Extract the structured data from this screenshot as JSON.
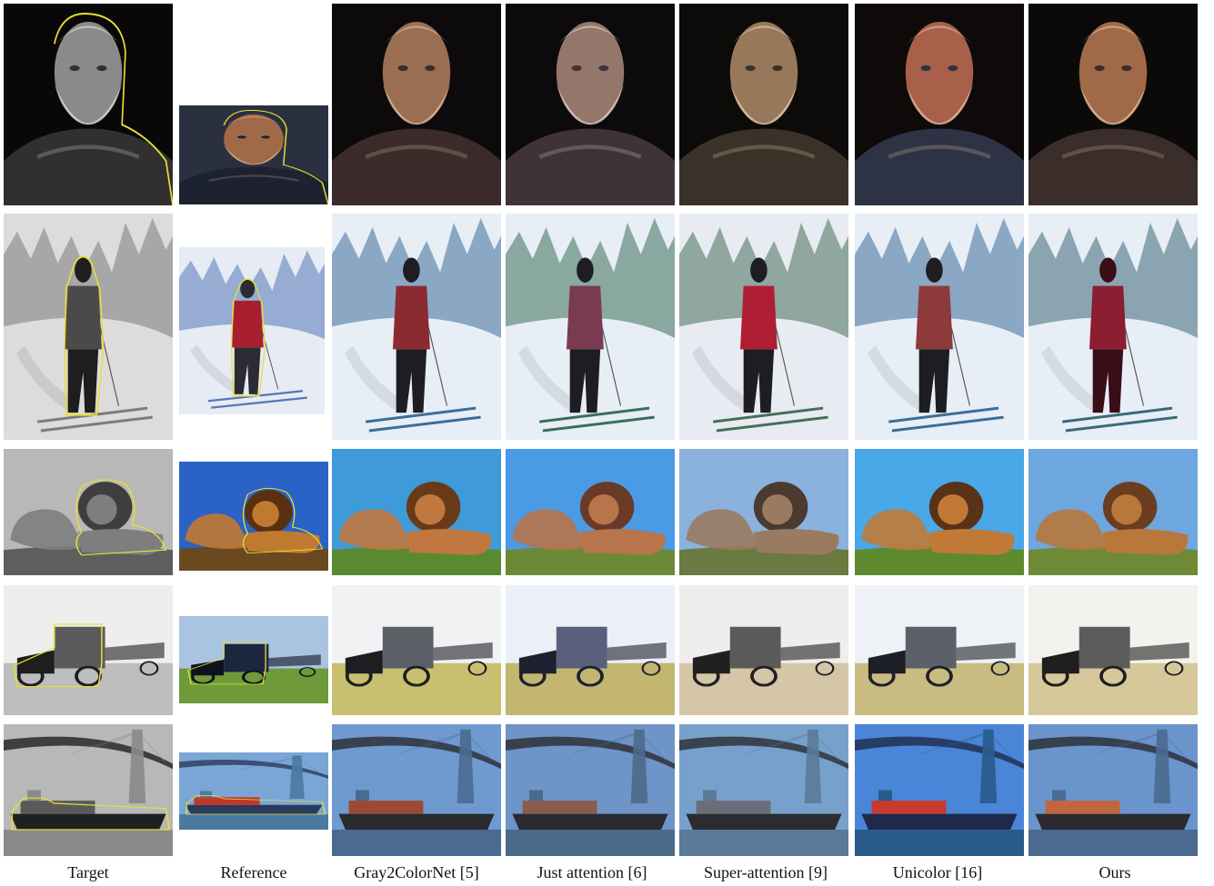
{
  "columns": [
    {
      "key": "target",
      "label": "Target"
    },
    {
      "key": "reference",
      "label": "Reference"
    },
    {
      "key": "gray2colornet",
      "label": "Gray2ColorNet [5]"
    },
    {
      "key": "just_attention",
      "label": "Just attention [6]"
    },
    {
      "key": "super_attention",
      "label": "Super-attention [9]"
    },
    {
      "key": "unicolor",
      "label": "Unicolor [16]"
    },
    {
      "key": "ours",
      "label": "Ours"
    }
  ],
  "rows": [
    {
      "subject": "portrait",
      "palettes": {
        "target": {
          "bg": "#080808",
          "main": "#8a8a8a",
          "dark": "#303030",
          "light": "#d6d6d6"
        },
        "reference": {
          "bg": "#2a3040",
          "main": "#a06a48",
          "dark": "#1c2230",
          "light": "#d9b08a"
        },
        "gray2colornet": {
          "bg": "#0c0a0a",
          "main": "#9a6e52",
          "dark": "#3b2b2b",
          "light": "#d9b79a"
        },
        "just_attention": {
          "bg": "#0c0a0c",
          "main": "#94766a",
          "dark": "#403338",
          "light": "#dcc8bc"
        },
        "super_attention": {
          "bg": "#0c0b09",
          "main": "#98785a",
          "dark": "#3a3228",
          "light": "#dcc6a8"
        },
        "unicolor": {
          "bg": "#0e0a0a",
          "main": "#a8604a",
          "dark": "#2d3344",
          "light": "#e0b89e"
        },
        "ours": {
          "bg": "#0c0a09",
          "main": "#a06a48",
          "dark": "#3b2d2a",
          "light": "#e0b896"
        }
      }
    },
    {
      "subject": "skier",
      "palettes": {
        "target": {
          "bg": "#dcdcdc",
          "main": "#4a4a4a",
          "dark": "#1e1e1e",
          "light": "#7c7c7c"
        },
        "reference": {
          "bg": "#e6ebf4",
          "main": "#a82030",
          "dark": "#2b2b33",
          "light": "#5478b8"
        },
        "gray2colornet": {
          "bg": "#e8eef6",
          "main": "#8c2a32",
          "dark": "#1e1e22",
          "light": "#3c6e9a"
        },
        "just_attention": {
          "bg": "#e8eef6",
          "main": "#7a3a52",
          "dark": "#1e1e22",
          "light": "#3a6f5a"
        },
        "super_attention": {
          "bg": "#e8ecf2",
          "main": "#b01e34",
          "dark": "#1e1e22",
          "light": "#46705a"
        },
        "unicolor": {
          "bg": "#e8eef6",
          "main": "#8e3a3a",
          "dark": "#1e1e22",
          "light": "#3c6e9a"
        },
        "ours": {
          "bg": "#e8eef6",
          "main": "#8c1e32",
          "dark": "#3a0e18",
          "light": "#3c6a78"
        }
      }
    },
    {
      "subject": "lions",
      "palettes": {
        "target": {
          "bg": "#b8b8b8",
          "main": "#7e7e7e",
          "dark": "#3e3e3e",
          "light": "#5e5e5e"
        },
        "reference": {
          "bg": "#2a62c8",
          "main": "#c07a30",
          "dark": "#5a3010",
          "light": "#6a4820"
        },
        "gray2colornet": {
          "bg": "#3e9ad8",
          "main": "#c07840",
          "dark": "#6a3a18",
          "light": "#5a8a30"
        },
        "just_attention": {
          "bg": "#4a9ae6",
          "main": "#b8744a",
          "dark": "#6a3a28",
          "light": "#6a8a38"
        },
        "super_attention": {
          "bg": "#8ab2dc",
          "main": "#9a7a60",
          "dark": "#4a3a30",
          "light": "#6a7a40"
        },
        "unicolor": {
          "bg": "#48a8e8",
          "main": "#c07a36",
          "dark": "#5a3218",
          "light": "#5e8a2e"
        },
        "ours": {
          "bg": "#6ea6e0",
          "main": "#b8783c",
          "dark": "#6a3e1e",
          "light": "#6e8a36"
        }
      }
    },
    {
      "subject": "truck",
      "palettes": {
        "target": {
          "bg": "#eeeeee",
          "main": "#5a5a5a",
          "dark": "#1e1e1e",
          "light": "#bdbdbd"
        },
        "reference": {
          "bg": "#a9c4e0",
          "main": "#1c2640",
          "dark": "#0e1220",
          "light": "#6e9a3a"
        },
        "gray2colornet": {
          "bg": "#f0f2f4",
          "main": "#5c6066",
          "dark": "#1e1e22",
          "light": "#c8c070"
        },
        "just_attention": {
          "bg": "#eaf0f6",
          "main": "#5a607c",
          "dark": "#1e2030",
          "light": "#c2b670"
        },
        "super_attention": {
          "bg": "#f0eeec",
          "main": "#5a5a5a",
          "dark": "#202020",
          "light": "#d4c6a6"
        },
        "unicolor": {
          "bg": "#eef2f6",
          "main": "#5c6068",
          "dark": "#1e2028",
          "light": "#c8bc80"
        },
        "ours": {
          "bg": "#f4f2ee",
          "main": "#5c5c5c",
          "dark": "#1e1e1e",
          "light": "#d6c89a"
        }
      }
    },
    {
      "subject": "ship",
      "palettes": {
        "target": {
          "bg": "#b8b8b8",
          "main": "#5a5a5a",
          "dark": "#202020",
          "light": "#8a8a8a"
        },
        "reference": {
          "bg": "#7aa6d6",
          "main": "#c0382a",
          "dark": "#2a3a5a",
          "light": "#4a7aa0"
        },
        "gray2colornet": {
          "bg": "#6e9ad0",
          "main": "#9a4a32",
          "dark": "#2a2a30",
          "light": "#4a6a90"
        },
        "just_attention": {
          "bg": "#6e94c8",
          "main": "#8a5a4a",
          "dark": "#2a2a30",
          "light": "#4a6a8a"
        },
        "super_attention": {
          "bg": "#78a0cc",
          "main": "#6a6e78",
          "dark": "#2a2c30",
          "light": "#5a7a98"
        },
        "unicolor": {
          "bg": "#4a86d8",
          "main": "#c83a2e",
          "dark": "#1e2a4a",
          "light": "#2a5a8a"
        },
        "ours": {
          "bg": "#6a94cc",
          "main": "#c0663e",
          "dark": "#2a2a30",
          "light": "#4a6a90"
        }
      }
    }
  ]
}
